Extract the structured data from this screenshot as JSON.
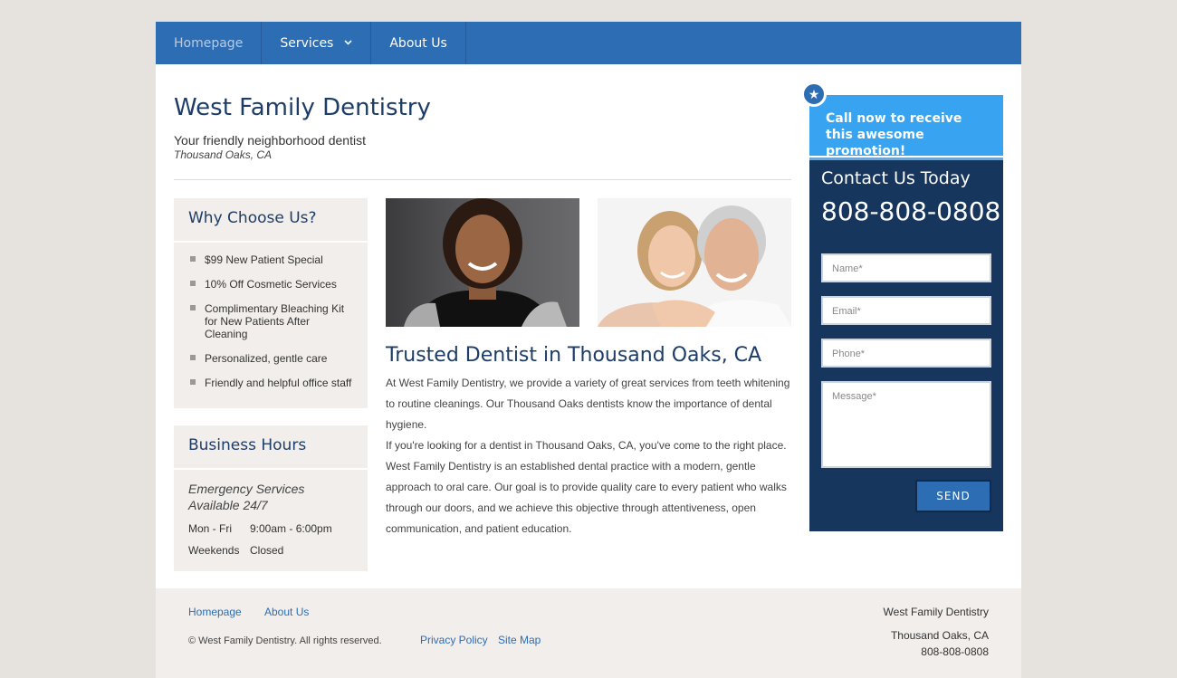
{
  "nav": {
    "items": [
      {
        "label": "Homepage"
      },
      {
        "label": "Services"
      },
      {
        "label": "About Us"
      }
    ]
  },
  "header": {
    "title": "West Family Dentistry",
    "tagline": "Your friendly neighborhood dentist",
    "location": "Thousand Oaks, CA"
  },
  "why": {
    "title": "Why Choose Us?",
    "items": [
      "$99 New Patient Special",
      "10% Off Cosmetic Services",
      "Complimentary Bleaching Kit for New Patients After Cleaning",
      "Personalized, gentle care",
      "Friendly and helpful office staff"
    ]
  },
  "hours": {
    "title": "Business Hours",
    "emergency": "Emergency Services Available 24/7",
    "rows": [
      {
        "day": "Mon - Fri",
        "time": "9:00am - 6:00pm"
      },
      {
        "day": "Weekends",
        "time": "Closed"
      }
    ]
  },
  "main": {
    "title": "Trusted Dentist in Thousand Oaks, CA",
    "para1": "At West Family Dentistry, we provide a variety of great services from teeth whitening to routine cleanings. Our Thousand Oaks dentists know the importance of dental hygiene.",
    "para2": "If you're looking for a dentist in Thousand Oaks, CA, you've come to the right place. West Family Dentistry is an established dental practice with a modern, gentle approach to oral care. Our goal is to provide quality care to every patient who walks through our doors, and we achieve this objective through attentiveness, open communication, and patient education."
  },
  "promo": {
    "text": "Call now to receive this awesome promotion!"
  },
  "contact": {
    "title": "Contact Us Today",
    "phone": "808-808-0808",
    "name_placeholder": "Name*",
    "email_placeholder": "Email*",
    "phone_placeholder": "Phone*",
    "message_placeholder": "Message*",
    "send_label": "SEND"
  },
  "footer": {
    "links_top": [
      "Homepage",
      "About Us"
    ],
    "copyright": "© West Family Dentistry. All rights reserved.",
    "links_bottom": [
      "Privacy Policy",
      "Site Map"
    ],
    "business_name": "West Family Dentistry",
    "city": "Thousand Oaks, CA",
    "phone": "808-808-0808"
  },
  "colors": {
    "nav_bg": "#2d6db4",
    "heading": "#1d3d68",
    "promo_bg": "#38a3f0",
    "contact_bg": "#17365d"
  }
}
